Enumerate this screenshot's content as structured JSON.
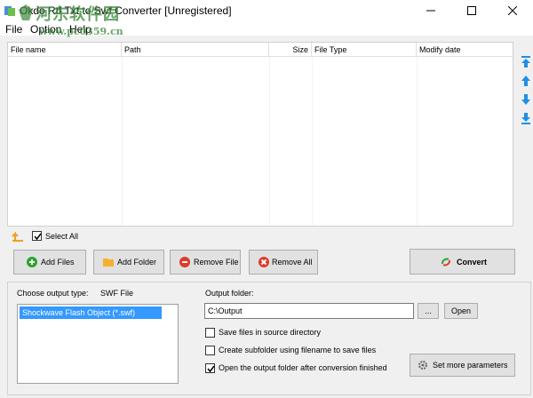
{
  "window": {
    "title": "Okdo Rtf Txt to Swf Converter [Unregistered]",
    "controls": {
      "minimize": "minimize",
      "maximize": "maximize",
      "close": "close"
    }
  },
  "watermark": {
    "main": "河东软件园",
    "sub": "www.pc0359.cn"
  },
  "menu": {
    "file": "File",
    "option": "Option",
    "help": "Help"
  },
  "file_list": {
    "columns": [
      "File name",
      "Path",
      "Size",
      "File Type",
      "Modify date"
    ],
    "rows": []
  },
  "select_all": {
    "label": "Select All",
    "checked": true
  },
  "buttons": {
    "add_files": "Add Files",
    "add_folder": "Add Folder",
    "remove_file": "Remove File",
    "remove_all": "Remove All",
    "convert": "Convert"
  },
  "output": {
    "type_label": "Choose output type:",
    "type_value": "SWF File",
    "types": [
      "Shockwave Flash Object (*.swf)"
    ],
    "folder_label": "Output folder:",
    "folder_value": "C:\\Output",
    "browse_label": "...",
    "open_label": "Open"
  },
  "options": {
    "save_in_source": {
      "label": "Save files in source directory",
      "checked": false
    },
    "create_subfolder": {
      "label": "Create subfolder using filename to save files",
      "checked": false
    },
    "open_after": {
      "label": "Open the output folder after conversion finished",
      "checked": true
    }
  },
  "set_params_label": "Set more parameters",
  "colors": {
    "selection": "#3399ff",
    "arrow_blue": "#1e90e6",
    "add_green": "#2aa52a",
    "remove_red": "#e03a2a"
  }
}
